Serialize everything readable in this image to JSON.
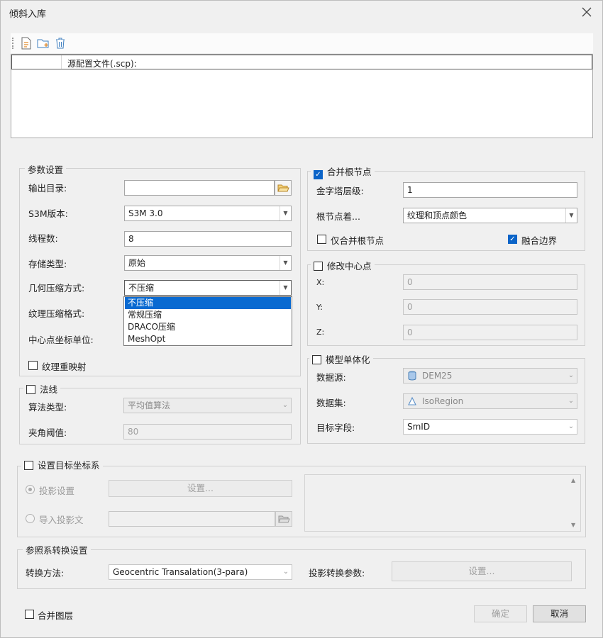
{
  "window": {
    "title": "倾斜入库"
  },
  "file_table": {
    "header": "源配置文件(.scp):"
  },
  "params": {
    "title": "参数设置",
    "output_dir_label": "输出目录:",
    "output_dir_value": "",
    "s3m_label": "S3M版本:",
    "s3m_value": "S3M 3.0",
    "threads_label": "线程数:",
    "threads_value": "8",
    "storage_label": "存储类型:",
    "storage_value": "原始",
    "geo_compress_label": "几何压缩方式:",
    "geo_compress_value": "不压缩",
    "texture_compress_label": "纹理压缩格式:",
    "center_unit_label": "中心点坐标单位:",
    "texture_remap_label": "纹理重映射",
    "geo_options": [
      "不压缩",
      "常规压缩",
      "DRACO压缩",
      "MeshOpt"
    ]
  },
  "normal": {
    "title": "法线",
    "algo_label": "算法类型:",
    "algo_value": "平均值算法",
    "angle_label": "夹角阈值:",
    "angle_value": "80"
  },
  "merge_root": {
    "title": "合并根节点",
    "pyramid_label": "金字塔层级:",
    "pyramid_value": "1",
    "root_label": "根节点着...",
    "root_value": "纹理和顶点颜色",
    "only_merge_label": "仅合并根节点",
    "fuse_label": "融合边界"
  },
  "center": {
    "title": "修改中心点",
    "x_label": "X:",
    "x_value": "0",
    "y_label": "Y:",
    "y_value": "0",
    "z_label": "Z:",
    "z_value": "0"
  },
  "model": {
    "title": "模型单体化",
    "source_label": "数据源:",
    "source_value": "DEM25",
    "dataset_label": "数据集:",
    "dataset_value": "IsoRegion",
    "field_label": "目标字段:",
    "field_value": "SmID"
  },
  "target_crs": {
    "title": "设置目标坐标系",
    "proj_label": "投影设置",
    "proj_button": "设置...",
    "import_label": "导入投影文"
  },
  "transform": {
    "title": "参照系转换设置",
    "method_label": "转换方法:",
    "method_value": "Geocentric Transalation(3-para)",
    "params_label": "投影转换参数:",
    "params_button": "设置..."
  },
  "footer": {
    "merge_layers_label": "合并图层",
    "ok": "确定",
    "cancel": "取消"
  },
  "colors": {
    "accent": "#0b64c8",
    "selection": "#0a6ad1"
  }
}
